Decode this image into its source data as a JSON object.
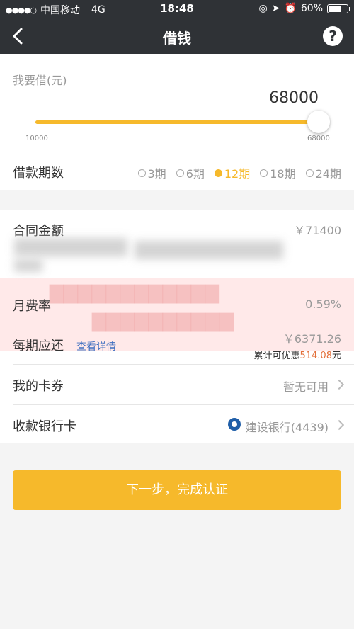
{
  "status_bar": {
    "carrier": "中国移动",
    "network": "4G",
    "time": "18:48",
    "battery": "60%"
  },
  "nav": {
    "title": "借钱",
    "back_icon": "chevron-left-icon",
    "help_icon": "question-icon"
  },
  "loan": {
    "amount_label": "我要借(元)",
    "amount": "68000",
    "slider_value": 68000,
    "slider_min": "10000",
    "slider_max": "68000",
    "term_label": "借款期数",
    "terms": [
      {
        "label": "3期",
        "selected": false
      },
      {
        "label": "6期",
        "selected": false
      },
      {
        "label": "12期",
        "selected": true
      },
      {
        "label": "18期",
        "selected": false
      },
      {
        "label": "24期",
        "selected": false
      }
    ]
  },
  "details": {
    "contract_label": "合同金额",
    "contract_amount": "￥71400",
    "monthly_rate_label": "月费率",
    "monthly_rate": "0.59%",
    "installment_label": "每期应还",
    "installment_link": "查看详情",
    "installment_amount": "￥6371.26",
    "savings_prefix": "累计可优惠",
    "savings_amount": "514.08",
    "savings_suffix": "元",
    "coupon_label": "我的卡券",
    "coupon_value": "暂无可用",
    "bank_label": "收款银行卡",
    "bank_value": "建设银行(4439)"
  },
  "next_button": "下一步，完成认证",
  "colors": {
    "accent": "#f6b92b",
    "header": "#2f3236",
    "link": "#3f6fc0",
    "savings": "#e36f3a"
  }
}
